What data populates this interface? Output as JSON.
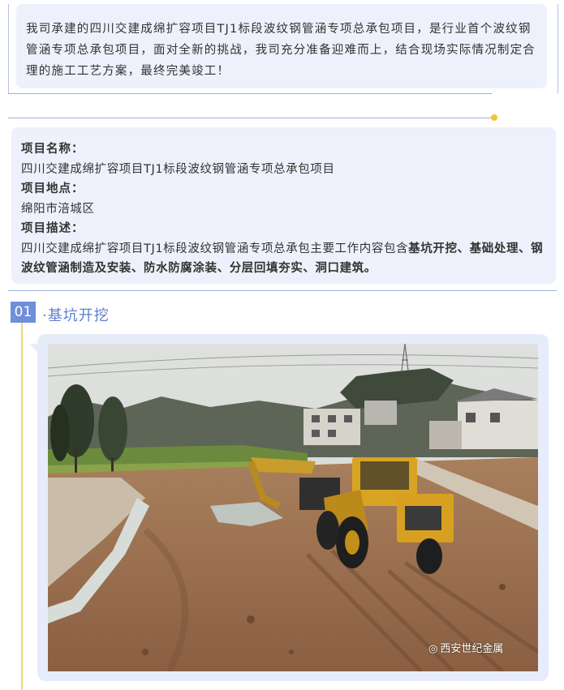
{
  "intro": {
    "text": "我司承建的四川交建成绵扩容项目TJ1标段波纹钢管涵专项总承包项目，是行业首个波纹钢管涵专项总承包项目，面对全新的挑战，我司充分准备迎难而上，结合现场实际情况制定合理的施工工艺方案，最终完美竣工！"
  },
  "info": {
    "name_label": "项目名称：",
    "name_value": "四川交建成绵扩容项目TJ1标段波纹钢管涵专项总承包项目",
    "location_label": "项目地点：",
    "location_value": "绵阳市涪城区",
    "desc_label": "项目描述：",
    "desc_prefix": "四川交建成绵扩容项目TJ1标段波纹钢管涵专项总承包主要工作内容包含",
    "desc_bold": "基坑开挖、基础处理、钢波纹管涵制造及安装、防水防腐涂装、分层回填夯实、洞口建筑。"
  },
  "section": {
    "number": "01",
    "title": "·基坑开挖"
  },
  "photo": {
    "watermark": "西安世纪金属",
    "watermark_icon": "wechat-icon"
  },
  "colors": {
    "accent": "#6f8fd8",
    "panel": "#eef1fb",
    "line": "#9fb0e0",
    "gold": "#f3c52b"
  }
}
